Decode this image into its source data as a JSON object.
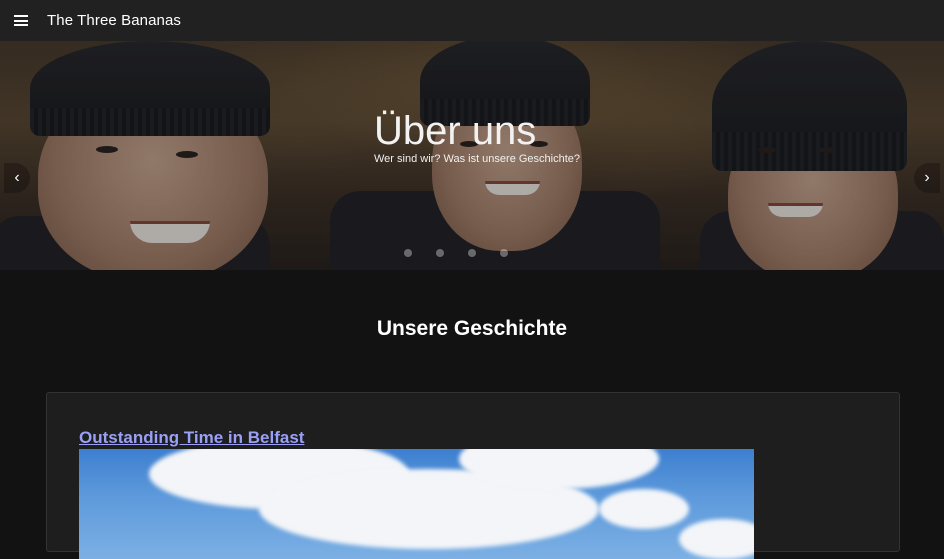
{
  "topbar": {
    "title": "The Three Bananas"
  },
  "hero": {
    "title": "Über uns",
    "subtitle": "Wer sind wir? Was ist unsere Geschichte?",
    "slide_count": 4,
    "active_slide": 1
  },
  "main": {
    "section_title": "Unsere Geschichte",
    "story": {
      "title": "Outstanding Time in Belfast"
    }
  },
  "colors": {
    "topbar": "#212121",
    "background": "#121212",
    "link": "#9aa0f7",
    "card": "#1e1e1e"
  }
}
